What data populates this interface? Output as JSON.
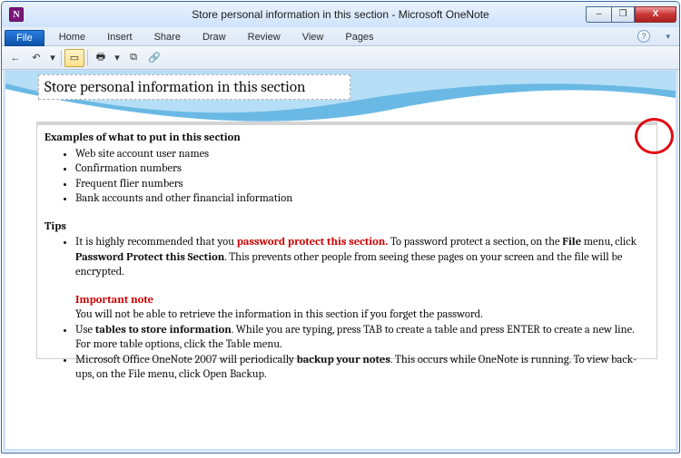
{
  "window": {
    "title": "Store personal information in this section - Microsoft OneNote",
    "app_icon_letter": "N",
    "buttons": {
      "minimize": "–",
      "maximize": "❐",
      "close": "X"
    }
  },
  "ribbon": {
    "file": "File",
    "tabs": [
      "Home",
      "Insert",
      "Share",
      "Draw",
      "Review",
      "View",
      "Pages"
    ]
  },
  "qat": {
    "back": "←",
    "undo": "↶",
    "drop": "▾",
    "fullpage": "▭",
    "print": "🖶",
    "drop2": "▾",
    "dock": "⧉",
    "link": "🔗"
  },
  "page": {
    "title": "Store personal information in this section",
    "heading1": "Examples of what to put in this section",
    "examples": [
      "Web site account user names",
      "Confirmation numbers",
      "Frequent flier numbers",
      "Bank accounts and other financial information"
    ],
    "heading2": "Tips",
    "tip1_a": "It is highly recommended that you ",
    "tip1_b": "password protect this section.",
    "tip1_c": " To password protect a section, on the ",
    "tip1_d": "File",
    "tip1_e": " menu, click ",
    "tip1_f": "Password Protect this Section",
    "tip1_g": ". This prevents other people from seeing these pages on your screen and the file will be encrypted.",
    "important_label": "Important note",
    "important_text": "You will not be able to retrieve the information in this section if you forget the password.",
    "tip2_a": "Use ",
    "tip2_b": "tables to store information",
    "tip2_c": ". While you are typing, press TAB to create a table and press ENTER to create a new line. For more table options, click the Table menu.",
    "tip3_a": "Microsoft Office OneNote 2007 will periodically ",
    "tip3_b": "backup your notes",
    "tip3_c": ". This occurs while OneNote is running. To view back-ups, on the File menu, click Open Backup."
  }
}
